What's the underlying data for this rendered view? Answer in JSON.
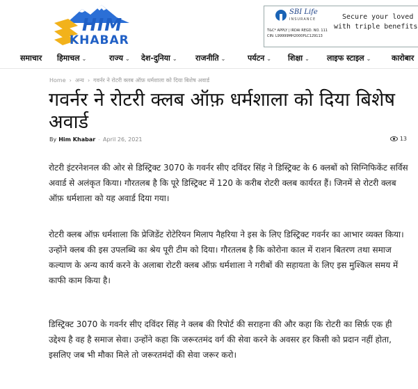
{
  "site": {
    "logo_text_top": "HIM",
    "logo_text_bottom": "KHABAR",
    "brand_color": "#1f5fc5"
  },
  "ad": {
    "brand": "SBI Life",
    "brand_sub": "INSURANCE",
    "fine_print_1": "T&C* APPLY | IRDAI REGD. NO. 111",
    "fine_print_2": "CIN: L99999MH2000PLC129113",
    "tagline_1": "Secure your loved one",
    "tagline_2": "with triple benefits o"
  },
  "nav": {
    "items": [
      {
        "label": "समाचार",
        "dropdown": false
      },
      {
        "label": "हिमाचल",
        "dropdown": true
      },
      {
        "label": "राज्य",
        "dropdown": true
      },
      {
        "label": "देश-दुनिया",
        "dropdown": true
      },
      {
        "label": "राजनीति",
        "dropdown": true
      },
      {
        "label": "पर्यटन",
        "dropdown": true
      },
      {
        "label": "शिक्षा",
        "dropdown": true
      },
      {
        "label": "लाइफ स्टाइल",
        "dropdown": true
      },
      {
        "label": "कारोबार",
        "dropdown": false
      }
    ]
  },
  "breadcrumb": {
    "home": "Home",
    "category": "अन्य",
    "current": "गवर्नर ने रोटरी क्लब ऑफ़ धर्मशाला को दिया बिशेष अवार्ड",
    "separator": "›"
  },
  "article": {
    "title": "गवर्नर ने रोटरी क्लब ऑफ़ धर्मशाला को दिया बिशेष अवार्ड",
    "by_label": "By",
    "author": "Him Khabar",
    "date_sep": "-",
    "date": "April 26, 2021",
    "views": "13",
    "paragraphs": [
      "रोटरी इंटरनेशनल की ओर से डिस्ट्रिक्ट 3070 के गवर्नर सीए दविंदर सिंह ने डिस्ट्रिक्ट के 6 क्लबों को सिग्निफिकेंट सर्विस अवार्ड से अलंकृत किया। गौरतलब है कि पूरे डिस्ट्रिक्ट में 120 के करीब रोटरी क्लब कार्यरत हैं। जिनमें से रोटरी क्लब ऑफ़ धर्मशाला को यह अवार्ड दिया गया।",
      "रोटरी क्लब ऑफ़ धर्मशाला कि प्रेजिडेंट रोटेरियन मिलाप नैहरिया ने इस के लिए डिस्ट्रिक्ट गवर्नर का आभार व्यक्त किया। उन्होंने क्लब की इस उपलब्धि का श्रेय पूरी टीम को दिया। गौरतलब है कि कोरोना काल में राशन बितरण तथा समाज कल्याण के अन्य कार्य करने के अलाबा रोटरी क्लब ऑफ़ धर्मशाला ने गरीबों की सहायता के लिए इस मुश्किल समय में काफी काम किया है।",
      "डिस्ट्रिक्ट 3070 के गवर्नर सीए दविंदर सिंह ने क्लब की रिपोर्ट की सराहना की और कहा कि रोटरी का सिर्फ़ एक ही उद्देश्य है वह है समाज सेवा। उन्होंने कहा कि जरूरतमंद वर्ग की सेवा करने के अवसर हर किसी को प्रदान नहीं होता, इसलिए जब भी मौका मिले तो जरूरतमंदों की सेवा जरूर करो।"
    ]
  }
}
